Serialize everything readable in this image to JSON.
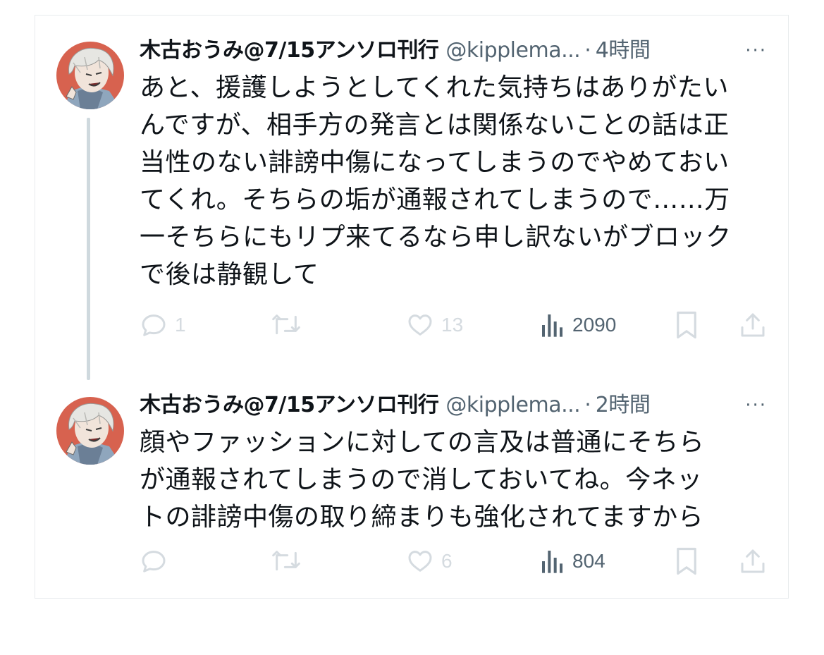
{
  "tweets": [
    {
      "display_name": "木古おうみ@7/15アンソロ刊行",
      "handle": "@kipplema...",
      "separator": "·",
      "time": "4時間",
      "more": "···",
      "text": "あと、援護しようとしてくれた気持ちはありがたい\nんですが、相手方の発言とは関係ないことの話は正\n当性のない誹謗中傷になってしまうのでやめておい\nてくれ。そちらの垢が通報されてしまうので……万\n一そちらにもリプ来てるなら申し訳ないがブロック\nで後は静観して",
      "replies": "1",
      "retweets": "",
      "likes": "13",
      "views": "2090"
    },
    {
      "display_name": "木古おうみ@7/15アンソロ刊行",
      "handle": "@kipplema...",
      "separator": "·",
      "time": "2時間",
      "more": "···",
      "text": "顔やファッションに対しての言及は普通にそちら\nが通報されてしまうので消しておいてね。今ネッ\nトの誹謗中傷の取り締まりも強化されてますから",
      "replies": "",
      "retweets": "",
      "likes": "6",
      "views": "804"
    }
  ],
  "icons": {
    "reply": "reply-icon",
    "retweet": "retweet-icon",
    "like": "heart-icon",
    "views": "analytics-icon",
    "bookmark": "bookmark-icon",
    "share": "share-icon"
  },
  "colors": {
    "text": "#0f1419",
    "secondary": "#536471",
    "faded_action": "#d5dbe0",
    "thread_line": "#cfd9de",
    "avatar_bg": "#d7624f"
  }
}
